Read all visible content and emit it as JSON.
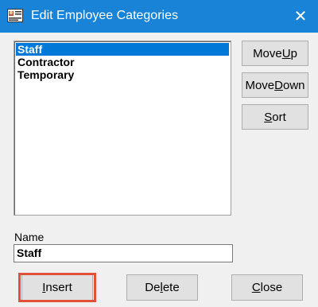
{
  "window": {
    "title": "Edit Employee Categories",
    "close_glyph": "✕",
    "titlebar_color": "#1883d7",
    "app_icon": "employee-card-icon"
  },
  "categories": {
    "items": [
      "Staff",
      "Contractor",
      "Temporary"
    ],
    "selected": "Staff",
    "selection_color": "#0078d7"
  },
  "side_buttons": {
    "move_up": {
      "before": "Move ",
      "key": "U",
      "after": "p"
    },
    "move_down": {
      "before": "Move ",
      "key": "D",
      "after": "own"
    },
    "sort": {
      "before": "",
      "key": "S",
      "after": "ort"
    }
  },
  "name_field": {
    "label": "Name",
    "value": "Staff"
  },
  "bottom_buttons": {
    "insert": {
      "before": "",
      "key": "I",
      "after": "nsert"
    },
    "delete": {
      "before": "De",
      "key": "l",
      "after": "ete"
    },
    "close": {
      "before": "",
      "key": "C",
      "after": "lose"
    }
  },
  "highlight_color": "#e0523a"
}
